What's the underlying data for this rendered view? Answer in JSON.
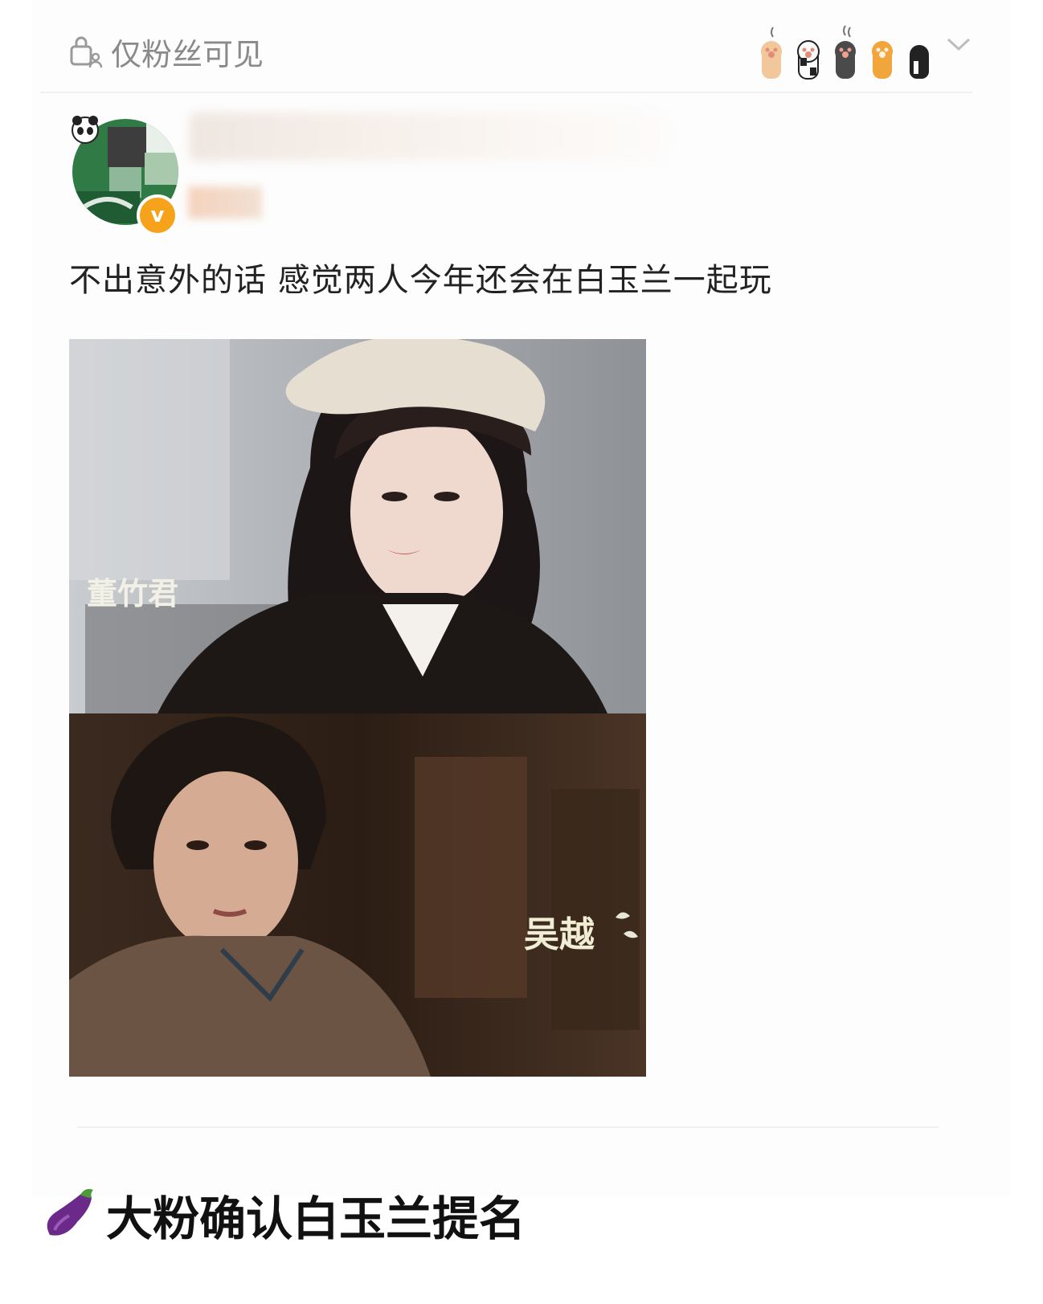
{
  "header": {
    "visibility_label": "仅粉丝可见"
  },
  "icons": {
    "visibility": "lock-person-icon",
    "decorations": [
      "cat-paw-icon",
      "cat-paw-icon",
      "cat-paw-icon",
      "cat-paw-icon",
      "cat-paw-icon"
    ],
    "menu": "chevron-down-icon",
    "badge": "verified-icon",
    "headline_emoji": "eggplant-icon"
  },
  "post": {
    "text": "不出意外的话 感觉两人今年还会在白玉兰一起玩",
    "image": {
      "top_caption": "董竹君",
      "bottom_caption": "吴越"
    }
  },
  "headline": {
    "text": "大粉确认白玉兰提名"
  },
  "colors": {
    "badge": "#f7a21b",
    "muted_text": "#8a8a8a",
    "body_text": "#222222"
  }
}
